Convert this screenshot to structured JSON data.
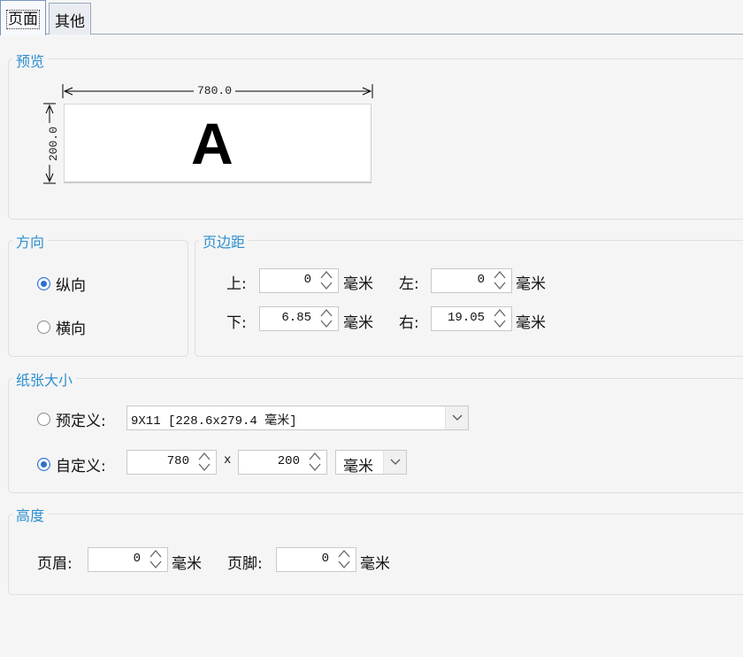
{
  "tabs": [
    "页面",
    "其他"
  ],
  "preview": {
    "legend": "预览",
    "width_label": "780.0",
    "height_label": "200.0",
    "letter": "A"
  },
  "orientation": {
    "legend": "方向",
    "options": [
      {
        "label": "纵向",
        "selected": true
      },
      {
        "label": "横向",
        "selected": false
      }
    ]
  },
  "margins": {
    "legend": "页边距",
    "top_label": "上:",
    "top_value": "0",
    "left_label": "左:",
    "left_value": "0",
    "bottom_label": "下:",
    "bottom_value": "6.85",
    "right_label": "右:",
    "right_value": "19.05",
    "unit": "毫米"
  },
  "paper": {
    "legend": "纸张大小",
    "predefined_label": "预定义:",
    "predefined_selected": false,
    "predefined_value": "9X11 [228.6x279.4 毫米]",
    "custom_label": "自定义:",
    "custom_selected": true,
    "width_value": "780",
    "times": "x",
    "height_value": "200",
    "unit_value": "毫米"
  },
  "height": {
    "legend": "高度",
    "header_label": "页眉:",
    "header_value": "0",
    "footer_label": "页脚:",
    "footer_value": "0",
    "unit": "毫米"
  },
  "colors": {
    "accent": "#2e8fd0",
    "radio": "#2e6fd0"
  }
}
